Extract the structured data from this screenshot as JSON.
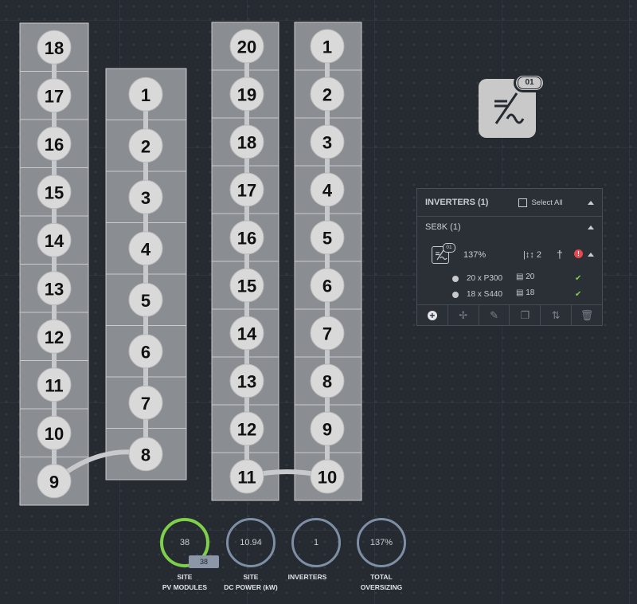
{
  "layout": {
    "strings": [
      {
        "id": "A",
        "modules": [
          "18",
          "17",
          "16",
          "15",
          "14",
          "13",
          "12",
          "11",
          "10",
          "9"
        ]
      },
      {
        "id": "B",
        "modules": [
          "1",
          "2",
          "3",
          "4",
          "5",
          "6",
          "7",
          "8"
        ]
      },
      {
        "id": "C",
        "modules": [
          "20",
          "19",
          "18",
          "17",
          "16",
          "15",
          "14",
          "13",
          "12",
          "11"
        ]
      },
      {
        "id": "D",
        "modules": [
          "1",
          "2",
          "3",
          "4",
          "5",
          "6",
          "7",
          "8",
          "9",
          "10"
        ]
      }
    ]
  },
  "inverter_icon": {
    "badge": "01",
    "icon": "dc-ac-inverter-icon"
  },
  "inverter_panel": {
    "header": "INVERTERS (1)",
    "select_all": "Select All",
    "model_group": "SE8K (1)",
    "inverter": {
      "badge": "01",
      "oversizing": "137%",
      "strings_count": "2",
      "status_icon": "error-icon"
    },
    "strings": [
      {
        "label": "20 x P300",
        "count": "20"
      },
      {
        "label": "18 x S440",
        "count": "18"
      }
    ],
    "toolbar": [
      "add-icon",
      "move-icon",
      "edit-icon",
      "duplicate-icon",
      "string-icon",
      "delete-icon"
    ]
  },
  "stats": [
    {
      "value": "38",
      "line1": "SITE",
      "line2": "PV MODULES",
      "tag": "38",
      "color": "#7ed04a"
    },
    {
      "value": "10.94",
      "line1": "SITE",
      "line2": "DC POWER (kW)",
      "color": "#7e8fa5"
    },
    {
      "value": "1",
      "line1": "",
      "line2": "INVERTERS",
      "color": "#7e8fa5"
    },
    {
      "value": "137%",
      "line1": "",
      "line2": "TOTAL OVERSIZING",
      "color": "#7e8fa5"
    }
  ],
  "colors": {
    "accent_green": "#7ed04a",
    "ring_grey": "#7e8fa5",
    "error_red": "#e5484d"
  }
}
